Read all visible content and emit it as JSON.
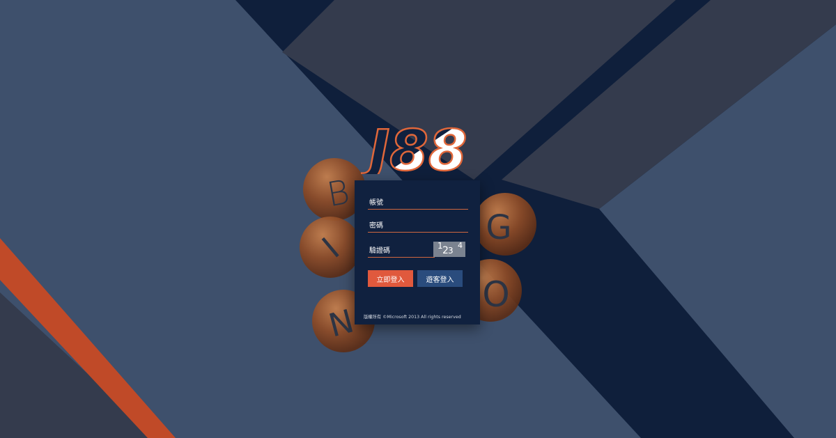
{
  "logo": {
    "text": "J88"
  },
  "balls": [
    "B",
    "I",
    "N",
    "G",
    "O"
  ],
  "form": {
    "account_placeholder": "帳號",
    "password_placeholder": "密碼",
    "captcha_placeholder": "驗證碼",
    "captcha_chars": [
      "1",
      "2",
      "3",
      "4"
    ],
    "login_button": "立即登入",
    "guest_button": "遊客登入"
  },
  "footer": {
    "copyright": "版權所有 ©Microsoft 2013 All rights reserved"
  },
  "colors": {
    "accent_orange": "#e0593d",
    "guest_blue": "#2a4c7d",
    "panel_navy": "#10213f",
    "field_underline": "#d1683f"
  }
}
